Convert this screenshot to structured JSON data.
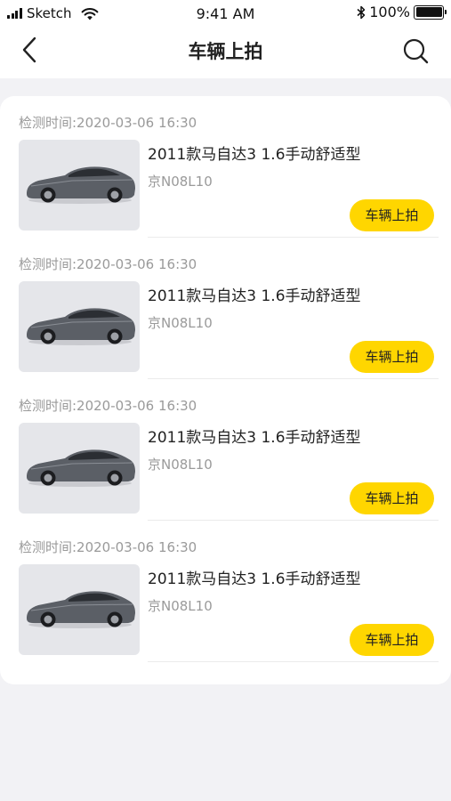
{
  "status_bar": {
    "carrier": "Sketch",
    "time": "9:41 AM",
    "battery_percent": "100%"
  },
  "nav": {
    "title": "车辆上拍",
    "back_icon": "chevron-left-icon",
    "search_icon": "search-icon"
  },
  "colors": {
    "accent": "#ffd600",
    "background": "#f2f2f5",
    "muted_text": "#9a9a9a"
  },
  "items": [
    {
      "time": "检测时间:2020-03-06 16:30",
      "title": "2011款马自达3 1.6手动舒适型",
      "plate": "京N08L10",
      "button": "车辆上拍"
    },
    {
      "time": "检测时间:2020-03-06 16:30",
      "title": "2011款马自达3 1.6手动舒适型",
      "plate": "京N08L10",
      "button": "车辆上拍"
    },
    {
      "time": "检测时间:2020-03-06 16:30",
      "title": "2011款马自达3 1.6手动舒适型",
      "plate": "京N08L10",
      "button": "车辆上拍"
    },
    {
      "time": "检测时间:2020-03-06 16:30",
      "title": "2011款马自达3 1.6手动舒适型",
      "plate": "京N08L10",
      "button": "车辆上拍"
    }
  ]
}
